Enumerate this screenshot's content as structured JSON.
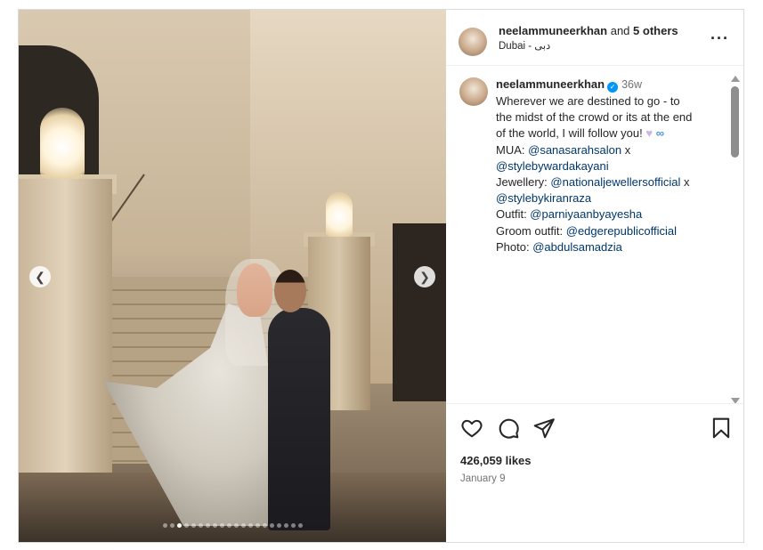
{
  "header": {
    "username": "neelammuneerkhan",
    "connector": " and ",
    "others": "5 others",
    "location": "Dubai - دبی"
  },
  "caption": {
    "username": "neelammuneerkhan",
    "time": "36w",
    "lines": [
      {
        "text": "Wherever we are destined to go - to"
      },
      {
        "text": "the midst of the crowd or its at the end"
      },
      {
        "text": "of the world, I will follow you! "
      },
      {
        "prefix": "MUA: ",
        "link": "@sanasarahsalon",
        "suffix": " x"
      },
      {
        "link": "@stylebywardakayani"
      },
      {
        "prefix": "Jewellery: ",
        "link": "@nationaljewellersofficial",
        "suffix": " x"
      },
      {
        "link": "@stylebykiranraza"
      },
      {
        "prefix": "Outfit: ",
        "link": "@parniyaanbyayesha"
      },
      {
        "prefix": "Groom outfit: ",
        "link": "@edgerepublicofficial"
      },
      {
        "prefix": "Photo: ",
        "link": "@abdulsamadzia"
      }
    ],
    "emoji_heart": "💜",
    "emoji_infinity": "∞"
  },
  "stats": {
    "likes": "426,059 likes",
    "date": "January 9"
  },
  "carousel": {
    "total": 20,
    "active": 2
  },
  "icons": {
    "more": "more-options-icon",
    "like": "heart-icon",
    "comment": "comment-icon",
    "share": "paper-plane-icon",
    "save": "bookmark-icon",
    "prev": "chevron-left-icon",
    "next": "chevron-right-icon",
    "verified": "verified-badge-icon"
  },
  "colors": {
    "link": "#00376b",
    "verified": "#0095f6",
    "muted": "#737373"
  }
}
